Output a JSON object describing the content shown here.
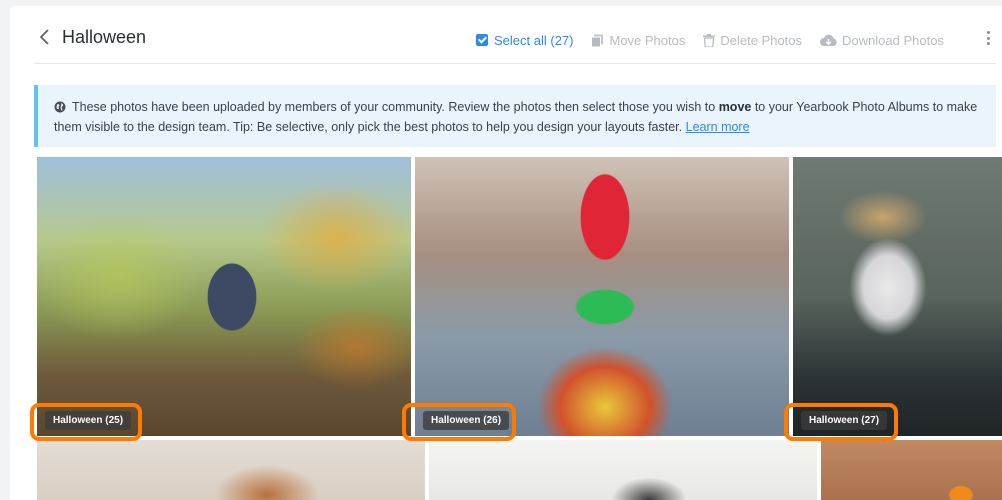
{
  "header": {
    "title": "Halloween",
    "select_all": "Select all (27)",
    "move": "Move Photos",
    "delete": "Delete Photos",
    "download": "Download Photos"
  },
  "notice": {
    "text_before": "These photos have been uploaded by members of your community. Review the photos then select those you wish to",
    "bold_word": "move",
    "text_after": "to your Yearbook Photo Albums to make them visible to the design team. Tip: Be selective, only pick the best photos to help you design your layouts faster.",
    "link": "Learn more"
  },
  "photos": [
    {
      "label": "Halloween (25)",
      "subject": "girl-on-broomstick"
    },
    {
      "label": "Halloween (26)",
      "subject": "clown-costume"
    },
    {
      "label": "Halloween (27)",
      "subject": "skeleton-face-paint"
    },
    {
      "subject": "child-green-mask"
    },
    {
      "subject": "child-helmet"
    },
    {
      "subject": "pumpkin-patch"
    }
  ],
  "colors": {
    "accent": "#2e8ae6",
    "highlight": "#ff7a00",
    "notice_bg": "#eaf4fd"
  }
}
